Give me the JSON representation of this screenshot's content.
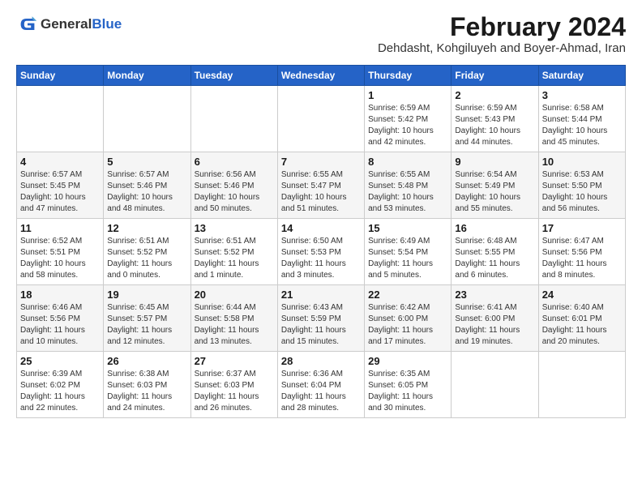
{
  "logo": {
    "general": "General",
    "blue": "Blue"
  },
  "header": {
    "title": "February 2024",
    "subtitle": "Dehdasht, Kohgiluyeh and Boyer-Ahmad, Iran"
  },
  "weekdays": [
    "Sunday",
    "Monday",
    "Tuesday",
    "Wednesday",
    "Thursday",
    "Friday",
    "Saturday"
  ],
  "weeks": [
    [
      {
        "day": "",
        "info": ""
      },
      {
        "day": "",
        "info": ""
      },
      {
        "day": "",
        "info": ""
      },
      {
        "day": "",
        "info": ""
      },
      {
        "day": "1",
        "info": "Sunrise: 6:59 AM\nSunset: 5:42 PM\nDaylight: 10 hours\nand 42 minutes."
      },
      {
        "day": "2",
        "info": "Sunrise: 6:59 AM\nSunset: 5:43 PM\nDaylight: 10 hours\nand 44 minutes."
      },
      {
        "day": "3",
        "info": "Sunrise: 6:58 AM\nSunset: 5:44 PM\nDaylight: 10 hours\nand 45 minutes."
      }
    ],
    [
      {
        "day": "4",
        "info": "Sunrise: 6:57 AM\nSunset: 5:45 PM\nDaylight: 10 hours\nand 47 minutes."
      },
      {
        "day": "5",
        "info": "Sunrise: 6:57 AM\nSunset: 5:46 PM\nDaylight: 10 hours\nand 48 minutes."
      },
      {
        "day": "6",
        "info": "Sunrise: 6:56 AM\nSunset: 5:46 PM\nDaylight: 10 hours\nand 50 minutes."
      },
      {
        "day": "7",
        "info": "Sunrise: 6:55 AM\nSunset: 5:47 PM\nDaylight: 10 hours\nand 51 minutes."
      },
      {
        "day": "8",
        "info": "Sunrise: 6:55 AM\nSunset: 5:48 PM\nDaylight: 10 hours\nand 53 minutes."
      },
      {
        "day": "9",
        "info": "Sunrise: 6:54 AM\nSunset: 5:49 PM\nDaylight: 10 hours\nand 55 minutes."
      },
      {
        "day": "10",
        "info": "Sunrise: 6:53 AM\nSunset: 5:50 PM\nDaylight: 10 hours\nand 56 minutes."
      }
    ],
    [
      {
        "day": "11",
        "info": "Sunrise: 6:52 AM\nSunset: 5:51 PM\nDaylight: 10 hours\nand 58 minutes."
      },
      {
        "day": "12",
        "info": "Sunrise: 6:51 AM\nSunset: 5:52 PM\nDaylight: 11 hours\nand 0 minutes."
      },
      {
        "day": "13",
        "info": "Sunrise: 6:51 AM\nSunset: 5:52 PM\nDaylight: 11 hours\nand 1 minute."
      },
      {
        "day": "14",
        "info": "Sunrise: 6:50 AM\nSunset: 5:53 PM\nDaylight: 11 hours\nand 3 minutes."
      },
      {
        "day": "15",
        "info": "Sunrise: 6:49 AM\nSunset: 5:54 PM\nDaylight: 11 hours\nand 5 minutes."
      },
      {
        "day": "16",
        "info": "Sunrise: 6:48 AM\nSunset: 5:55 PM\nDaylight: 11 hours\nand 6 minutes."
      },
      {
        "day": "17",
        "info": "Sunrise: 6:47 AM\nSunset: 5:56 PM\nDaylight: 11 hours\nand 8 minutes."
      }
    ],
    [
      {
        "day": "18",
        "info": "Sunrise: 6:46 AM\nSunset: 5:56 PM\nDaylight: 11 hours\nand 10 minutes."
      },
      {
        "day": "19",
        "info": "Sunrise: 6:45 AM\nSunset: 5:57 PM\nDaylight: 11 hours\nand 12 minutes."
      },
      {
        "day": "20",
        "info": "Sunrise: 6:44 AM\nSunset: 5:58 PM\nDaylight: 11 hours\nand 13 minutes."
      },
      {
        "day": "21",
        "info": "Sunrise: 6:43 AM\nSunset: 5:59 PM\nDaylight: 11 hours\nand 15 minutes."
      },
      {
        "day": "22",
        "info": "Sunrise: 6:42 AM\nSunset: 6:00 PM\nDaylight: 11 hours\nand 17 minutes."
      },
      {
        "day": "23",
        "info": "Sunrise: 6:41 AM\nSunset: 6:00 PM\nDaylight: 11 hours\nand 19 minutes."
      },
      {
        "day": "24",
        "info": "Sunrise: 6:40 AM\nSunset: 6:01 PM\nDaylight: 11 hours\nand 20 minutes."
      }
    ],
    [
      {
        "day": "25",
        "info": "Sunrise: 6:39 AM\nSunset: 6:02 PM\nDaylight: 11 hours\nand 22 minutes."
      },
      {
        "day": "26",
        "info": "Sunrise: 6:38 AM\nSunset: 6:03 PM\nDaylight: 11 hours\nand 24 minutes."
      },
      {
        "day": "27",
        "info": "Sunrise: 6:37 AM\nSunset: 6:03 PM\nDaylight: 11 hours\nand 26 minutes."
      },
      {
        "day": "28",
        "info": "Sunrise: 6:36 AM\nSunset: 6:04 PM\nDaylight: 11 hours\nand 28 minutes."
      },
      {
        "day": "29",
        "info": "Sunrise: 6:35 AM\nSunset: 6:05 PM\nDaylight: 11 hours\nand 30 minutes."
      },
      {
        "day": "",
        "info": ""
      },
      {
        "day": "",
        "info": ""
      }
    ]
  ]
}
